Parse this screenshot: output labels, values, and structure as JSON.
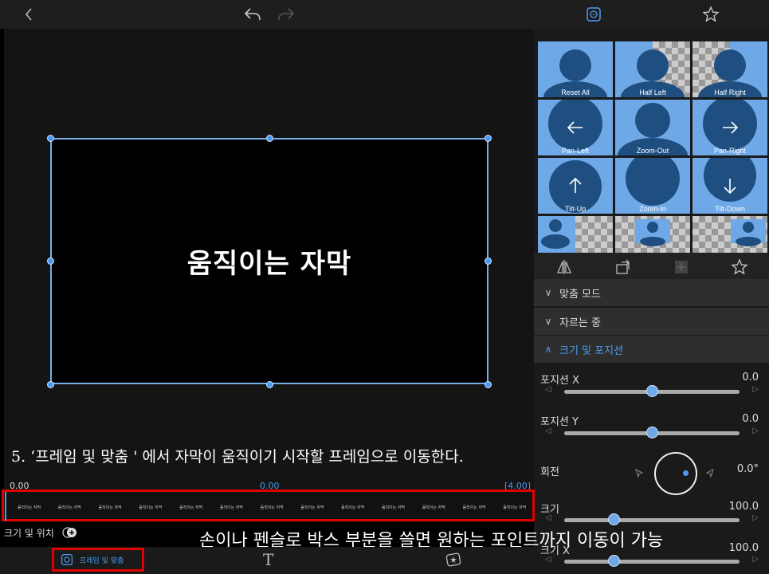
{
  "topbar": {
    "icons": [
      "back-icon",
      "undo-icon",
      "redo-icon",
      "frame-fit-icon",
      "star-icon"
    ]
  },
  "preview": {
    "caption": "움직이는 자막"
  },
  "presets": {
    "tiles": [
      {
        "label": "Reset All"
      },
      {
        "label": "Half Left"
      },
      {
        "label": "Half Right"
      },
      {
        "label": "Pan-Left"
      },
      {
        "label": "Zoom-Out"
      },
      {
        "label": "Pan-Right"
      },
      {
        "label": "Tilt-Up"
      },
      {
        "label": "Zoom-In"
      },
      {
        "label": "Tilt-Down"
      }
    ]
  },
  "panel_icons": [
    "flip-icon",
    "rotate-icon",
    "filter-icon",
    "star-icon"
  ],
  "sections": {
    "fit_mode": "맞춤 모드",
    "cropping": "자르는 중",
    "size_position": "크기 및 포지션"
  },
  "properties": {
    "pos_x": {
      "label": "포지션 X",
      "value": "0.0",
      "level": 0.5
    },
    "pos_y": {
      "label": "포지션 Y",
      "value": "0.0",
      "level": 0.5
    },
    "rotation": {
      "label": "회전",
      "value": "0.0°"
    },
    "size": {
      "label": "크기",
      "value": "100.0",
      "level": 0.28
    },
    "size_x": {
      "label": "크기 X",
      "value": "100.0",
      "level": 0.28
    }
  },
  "timeline": {
    "start": "0.00",
    "current": "0.00",
    "end": "[4.00]",
    "clip_label": "움직이는 자막",
    "clip_count": 13
  },
  "left_label": "크기 및 위치",
  "bottombar": {
    "frame_fit": "프레임 및 맞춤"
  },
  "annotations": {
    "step5": "5. ‘프레임 및 맞춤 ' 에서 자막이 움직이기 시작할 프레임으로 이동한다.",
    "hint": "손이나 펜슬로 박스 부분을 쓸면 원하는 포인트까지 이동이 가능"
  },
  "colors": {
    "accent": "#4a9cf0",
    "highlight": "#e00000",
    "tile": "#6fa8e6"
  }
}
